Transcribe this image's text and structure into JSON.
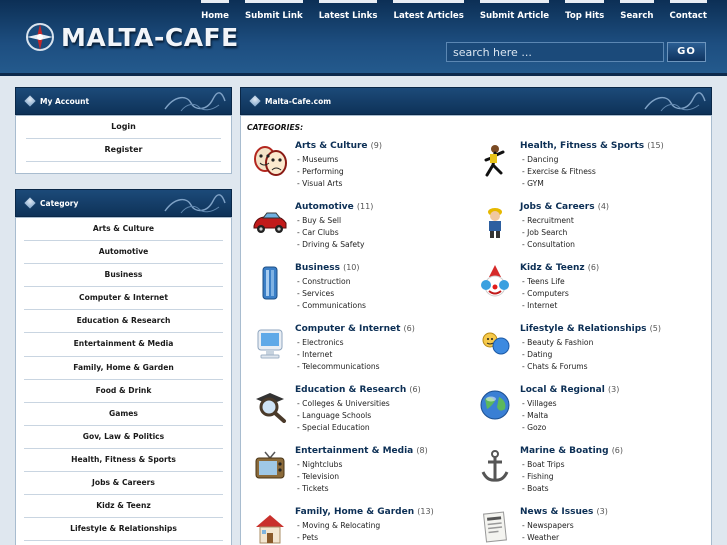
{
  "header": {
    "logo_text": "MALTA-CAFE",
    "nav": [
      "Home",
      "Submit Link",
      "Latest Links",
      "Latest Articles",
      "Submit Article",
      "Top Hits",
      "Search",
      "Contact"
    ],
    "search_placeholder": "search here ...",
    "go_label": "GO"
  },
  "account": {
    "title": "My Account",
    "links": [
      "Login",
      "Register"
    ]
  },
  "category_panel": {
    "title": "Category",
    "links": [
      "Arts & Culture",
      "Automotive",
      "Business",
      "Computer & Internet",
      "Education & Research",
      "Entertainment & Media",
      "Family, Home & Garden",
      "Food & Drink",
      "Games",
      "Gov, Law & Politics",
      "Health, Fitness & Sports",
      "Jobs & Careers",
      "Kidz & Teenz",
      "Lifestyle & Relationships"
    ]
  },
  "main": {
    "title": "Malta-Cafe.com",
    "heading": "CATEGORIES:",
    "categories": [
      {
        "name": "Arts & Culture",
        "count": "(9)",
        "icon": "theatre-masks-icon",
        "subs": [
          "- Museums",
          "- Performing",
          "- Visual Arts"
        ]
      },
      {
        "name": "Health, Fitness & Sports",
        "count": "(15)",
        "icon": "athlete-icon",
        "subs": [
          "- Dancing",
          "- Exercise & Fitness",
          "- GYM"
        ]
      },
      {
        "name": "Automotive",
        "count": "(11)",
        "icon": "car-icon",
        "subs": [
          "- Buy & Sell",
          "- Car Clubs",
          "- Driving & Safety"
        ]
      },
      {
        "name": "Jobs & Careers",
        "count": "(4)",
        "icon": "worker-icon",
        "subs": [
          "- Recruitment",
          "- Job Search",
          "- Consultation"
        ]
      },
      {
        "name": "Business",
        "count": "(10)",
        "icon": "building-icon",
        "subs": [
          "- Construction",
          "- Services",
          "- Communications"
        ]
      },
      {
        "name": "Kidz & Teenz",
        "count": "(6)",
        "icon": "clown-icon",
        "subs": [
          "- Teens Life",
          "- Computers",
          "- Internet"
        ]
      },
      {
        "name": "Computer & Internet",
        "count": "(6)",
        "icon": "computer-icon",
        "subs": [
          "- Electronics",
          "- Internet",
          "- Telecommunications"
        ]
      },
      {
        "name": "Lifestyle & Relationships",
        "count": "(5)",
        "icon": "people-icon",
        "subs": [
          "- Beauty & Fashion",
          "- Dating",
          "- Chats & Forums"
        ]
      },
      {
        "name": "Education & Research",
        "count": "(6)",
        "icon": "magnifier-icon",
        "subs": [
          "- Colleges & Universities",
          "- Language Schools",
          "- Special Education"
        ]
      },
      {
        "name": "Local & Regional",
        "count": "(3)",
        "icon": "globe-icon",
        "subs": [
          "- Villages",
          "- Malta",
          "- Gozo"
        ]
      },
      {
        "name": "Entertainment & Media",
        "count": "(8)",
        "icon": "television-icon",
        "subs": [
          "- Nightclubs",
          "- Television",
          "- Tickets"
        ]
      },
      {
        "name": "Marine & Boating",
        "count": "(6)",
        "icon": "anchor-icon",
        "subs": [
          "- Boat Trips",
          "- Fishing",
          "- Boats"
        ]
      },
      {
        "name": "Family, Home & Garden",
        "count": "(13)",
        "icon": "house-icon",
        "subs": [
          "- Moving & Relocating",
          "- Pets"
        ]
      },
      {
        "name": "News & Issues",
        "count": "(3)",
        "icon": "newspaper-icon",
        "subs": [
          "- Newspapers",
          "- Weather"
        ]
      }
    ]
  }
}
